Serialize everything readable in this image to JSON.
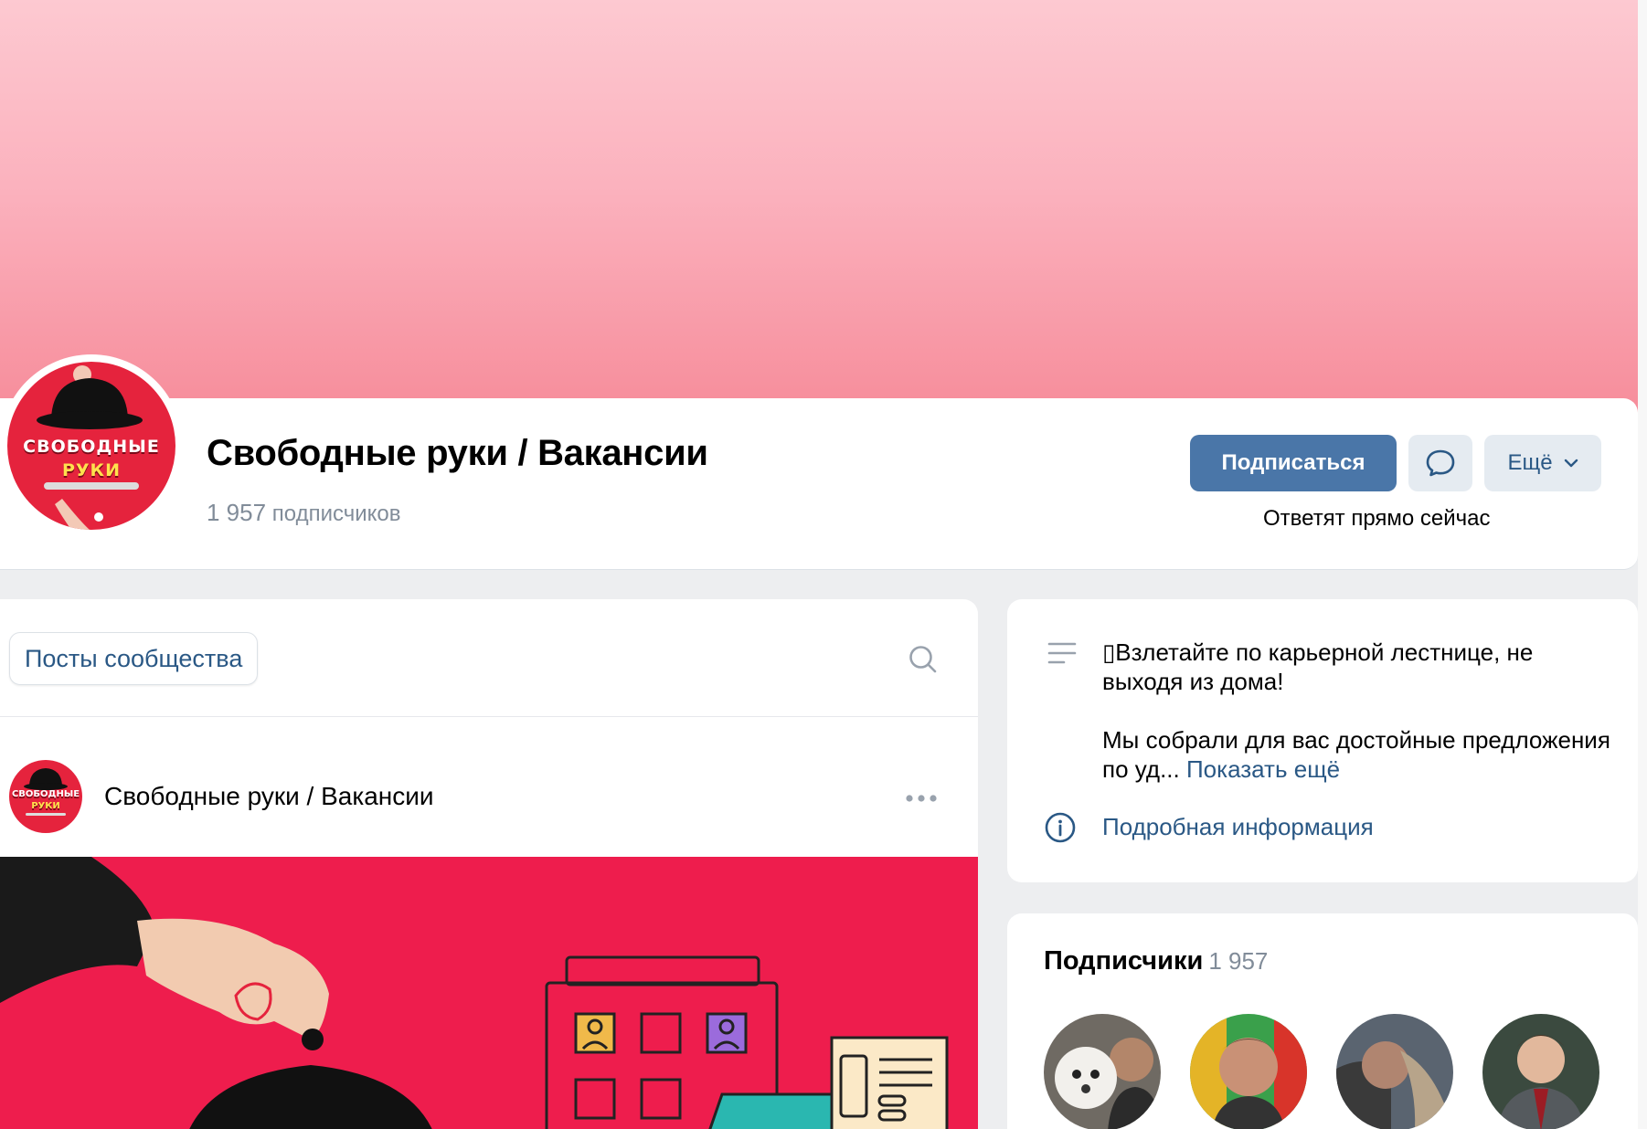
{
  "group": {
    "title": "Свободные руки / Вакансии",
    "subscribers_count": "1 957",
    "subscribers_label": "подписчиков",
    "logo_line1": "СВОБОДНЫЕ",
    "logo_line2": "РУКИ"
  },
  "actions": {
    "subscribe_label": "Подписаться",
    "message_icon": "message-icon",
    "more_label": "Ещё",
    "reply_note": "Ответят прямо сейчас"
  },
  "posts": {
    "tab_label": "Посты сообщества",
    "search_icon": "search-icon",
    "post": {
      "author": "Свободные руки / Вакансии",
      "menu_icon": "more-horizontal-icon"
    }
  },
  "info": {
    "text_line1": "▯Взлетайте по карьерной лестнице, не выходя из дома!",
    "text_line2": "Мы собрали для вас достойные предложения по уд...",
    "show_more": "Показать ещё",
    "details_link": "Подробная информация"
  },
  "members": {
    "title": "Подписчики",
    "count": "1 957"
  },
  "colors": {
    "accent": "#4a76a8",
    "link": "#2a5885",
    "brand_red": "#e5233d",
    "background": "#edeef0"
  }
}
